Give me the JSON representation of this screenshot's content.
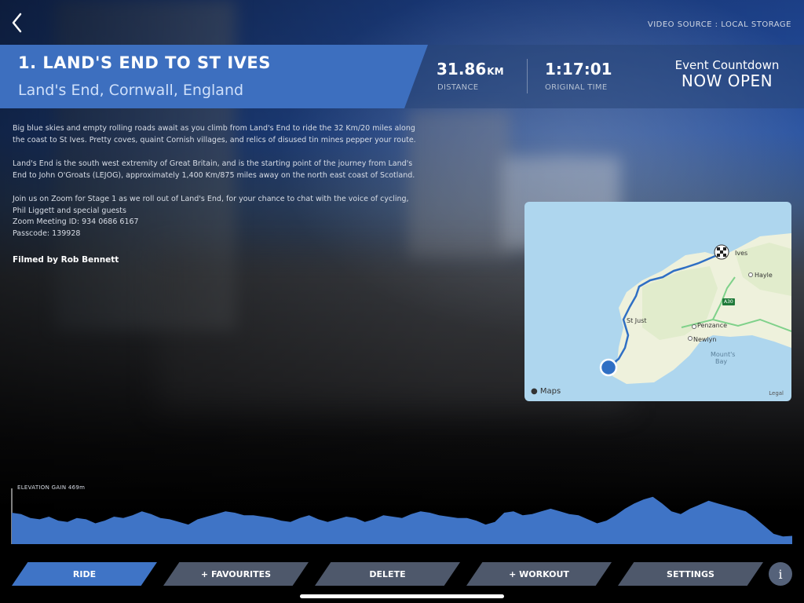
{
  "header": {
    "video_source": "VIDEO SOURCE : LOCAL STORAGE"
  },
  "route": {
    "title": "1. LAND'S END TO ST IVES",
    "location": "Land's End, Cornwall, England"
  },
  "stats": {
    "distance_value": "31.86",
    "distance_unit": "KM",
    "distance_label": "DISTANCE",
    "time_value": "1:17:01",
    "time_label": "ORIGINAL TIME",
    "countdown_label": "Event Countdown",
    "countdown_status": "NOW OPEN"
  },
  "description": {
    "p1": "Big blue skies and empty rolling roads await as you climb from Land's End to ride the 32 Km/20 miles along the coast to St Ives.  Pretty coves, quaint Cornish villages, and relics of disused tin mines pepper your route.",
    "p2": "Land's End is the south west extremity of Great Britain, and is the starting point of the journey from Land's End to John O'Groats (LEJOG), approximately 1,400 Km/875 miles away on the north east coast of Scotland.",
    "p3": "Join us on Zoom for Stage 1 as we roll out of Land's End, for your chance to chat with the voice of cycling, Phil Liggett and special guests",
    "zoom_id": "Zoom Meeting ID: 934 0686 6167",
    "passcode": "Passcode: 139928",
    "credit": "Filmed by Rob Bennett"
  },
  "map": {
    "places": {
      "st_ives": "Ives",
      "hayle": "Hayle",
      "st_just": "St Just",
      "penzance": "Penzance",
      "newlyn": "Newlyn",
      "mounts_bay_1": "Mount's",
      "mounts_bay_2": "Bay"
    },
    "road_badge": "A30",
    "attribution": "Maps",
    "legal": "Legal",
    "colors": {
      "route": "#2f6fc4",
      "sea": "#aed6ee",
      "land": "#eef1dc",
      "start_marker": "#2f6fc4"
    }
  },
  "elevation": {
    "label": "ELEVATION GAIN 469m",
    "fill_color": "#3f74c6",
    "profile": [
      38,
      36,
      30,
      28,
      32,
      26,
      24,
      30,
      28,
      22,
      26,
      32,
      30,
      34,
      40,
      36,
      30,
      28,
      24,
      20,
      28,
      32,
      36,
      40,
      38,
      34,
      34,
      32,
      30,
      26,
      24,
      30,
      34,
      28,
      24,
      28,
      32,
      30,
      24,
      28,
      34,
      32,
      30,
      36,
      40,
      38,
      34,
      32,
      30,
      30,
      26,
      20,
      24,
      38,
      40,
      34,
      36,
      40,
      44,
      40,
      36,
      34,
      28,
      22,
      26,
      34,
      44,
      52,
      58,
      62,
      52,
      40,
      36,
      44,
      50,
      56,
      52,
      48,
      44,
      40,
      30,
      18,
      6,
      2,
      3
    ]
  },
  "buttons": {
    "ride": "RIDE",
    "favourites": "+ FAVOURITES",
    "delete": "DELETE",
    "workout": "+ WORKOUT",
    "settings": "SETTINGS",
    "info": "i"
  }
}
